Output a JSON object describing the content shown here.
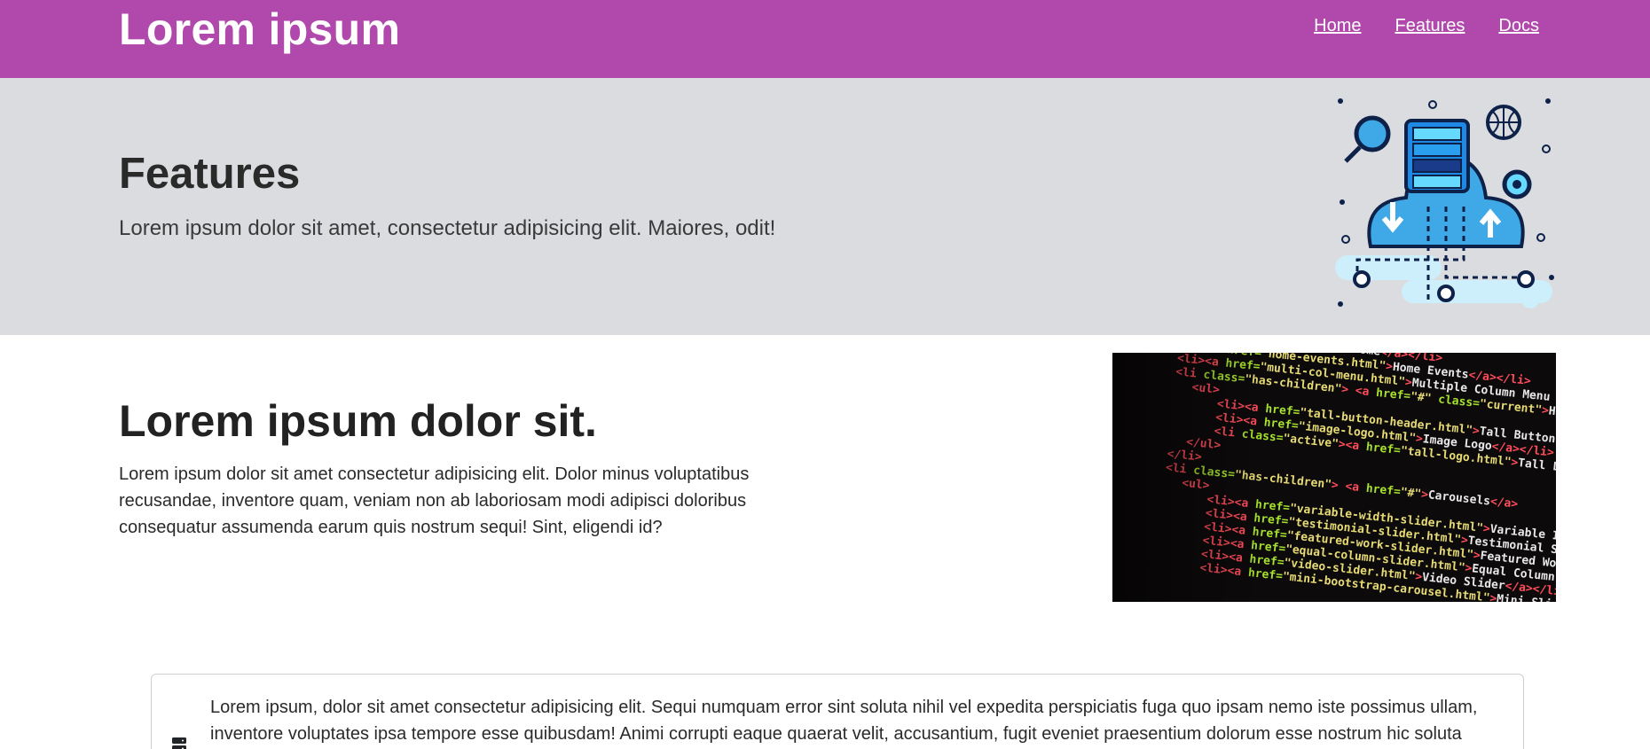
{
  "navbar": {
    "brand": "Lorem ipsum",
    "links": [
      "Home",
      "Features",
      "Docs"
    ],
    "color": "#b149ad"
  },
  "hero": {
    "title": "Features",
    "subtitle": "Lorem ipsum dolor sit amet, consectetur adipisicing elit. Maiores, odit!",
    "art_icon": "cloud-server-illustration"
  },
  "section": {
    "heading": "Lorem ipsum dolor sit.",
    "body": "Lorem ipsum dolor sit amet consectetur adipisicing elit. Dolor minus voluptatibus recusandae, inventore quam, veniam non ab laboriosam modi adipisci doloribus consequatur assumenda earum quis nostrum sequi! Sint, eligendi id?",
    "code_lines": [
      "<li><a href=\"index.html\">Home</a></li>",
      "<li><a href=\"home-events.html\">Home Events</a></li>",
      "<li><a href=\"multi-col-menu.html\">Multiple Column Menu on Larger Viewport</a>",
      "<li class=\"has-children\"> <a href=\"#\" class=\"current\">Header Options</a>",
      "<ul>",
      "<li><a href=\"tall-button-header.html\">Tall Button Header</a></li>",
      "<li><a href=\"image-logo.html\">Image Logo</a></li>",
      "<li class=\"active\"><a href=\"tall-logo.html\">Tall Logo Image</a></li>",
      "</ul>",
      "</li>",
      "<li class=\"has-children\"> <a href=\"#\">Carousels</a>",
      "<ul>",
      "<li><a href=\"variable-width-slider.html\">Variable Image Width</a></li>",
      "<li><a href=\"testimonial-slider.html\">Testimonial Slider</a></li>",
      "<li><a href=\"featured-work-slider.html\">Featured Work Slider</a></li>",
      "<li><a href=\"equal-column-slider.html\">Equal Column Slider</a></li>",
      "<li><a href=\"video-slider.html\">Video Slider</a></li>",
      "<li><a href=\"mini-bootstrap-carousel.html\">Mini Slider</a></li>"
    ]
  },
  "card": {
    "icon": "server-icon",
    "text": "Lorem ipsum, dolor sit amet consectetur adipisicing elit. Sequi numquam error sint soluta nihil vel expedita perspiciatis fuga quo ipsam nemo iste possimus ullam, inventore voluptates ipsa tempore esse quibusdam! Animi corrupti eaque quaerat velit, accusantium, fugit eveniet praesentium dolorum esse nostrum hic soluta"
  }
}
